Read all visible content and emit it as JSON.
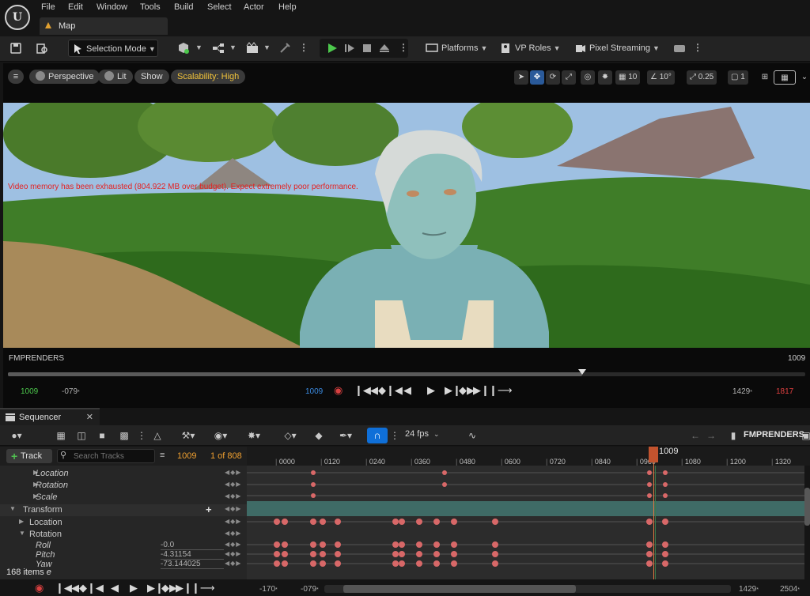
{
  "menu": {
    "items": [
      "File",
      "Edit",
      "Window",
      "Tools",
      "Build",
      "Select",
      "Actor",
      "Help"
    ],
    "tab_label": "Map"
  },
  "toolbar": {
    "selection_mode": "Selection Mode",
    "platforms": "Platforms",
    "vp_roles": "VP Roles",
    "pixel_streaming": "Pixel Streaming"
  },
  "viewport": {
    "perspective": "Perspective",
    "lit": "Lit",
    "show": "Show",
    "scalability": "Scalability: High",
    "grid_snap": "10",
    "rotation_snap": "10°",
    "scale_snap": "0.25",
    "camera_speed": "1",
    "warning": "Video memory has been exhausted (804.922 MB over budget). Expect extremely poor performance."
  },
  "viewport_timeline": {
    "title": "FMPRENDERS",
    "frame": "1009",
    "current": "1009",
    "start": "-079",
    "start_suffix": "*",
    "center": "1009",
    "view_end": "1429",
    "view_end_suffix": "*",
    "end": "1817",
    "progress": 0.72
  },
  "sequencer": {
    "tab_label": "Sequencer",
    "fps": "24 fps",
    "sequence_name": "FMPRENDERS",
    "add_track": "Track",
    "search_placeholder": "Search Tracks",
    "current_frame": "1009",
    "frame_of": "1 of 808",
    "items_count": "168 items",
    "items_suffix": "e",
    "playhead_label": "1009",
    "ruler_ticks": [
      "0000",
      "0120",
      "0240",
      "0360",
      "0480",
      "0600",
      "0720",
      "0840",
      "0960",
      "1080",
      "1200",
      "1320"
    ],
    "rows": [
      {
        "label": "Location",
        "indent": 1,
        "italic": true,
        "arrow": "right",
        "value": ""
      },
      {
        "label": "Rotation",
        "indent": 1,
        "italic": true,
        "arrow": "right",
        "value": ""
      },
      {
        "label": "Scale",
        "indent": 1,
        "italic": true,
        "arrow": "right",
        "value": ""
      },
      {
        "label": "Transform",
        "indent": 0,
        "italic": false,
        "arrow": "down",
        "value": ""
      },
      {
        "label": "Location",
        "indent": 1,
        "italic": false,
        "arrow": "right",
        "value": ""
      },
      {
        "label": "Rotation",
        "indent": 1,
        "italic": false,
        "arrow": "down",
        "value": ""
      },
      {
        "label": "Roll",
        "indent": 2,
        "italic": true,
        "arrow": "",
        "value": "-0.0"
      },
      {
        "label": "Pitch",
        "indent": 2,
        "italic": true,
        "arrow": "",
        "value": "-4.31154"
      },
      {
        "label": "Yaw",
        "indent": 2,
        "italic": true,
        "arrow": "",
        "value": "-73.144025"
      }
    ],
    "bottom": {
      "left_start": "-170",
      "left_start_suffix": "*",
      "left_cur": "-079",
      "left_cur_suffix": "*",
      "right_a": "1429",
      "right_a_suffix": "*",
      "right_b": "2504",
      "right_b_suffix": "*"
    }
  },
  "colors": {
    "accent_blue": "#0f6fd8",
    "play_green": "#4cc84c",
    "warning_red": "#e52020",
    "frame_orange": "#f0a030",
    "key_red": "#d86868",
    "scalability_yellow": "#f0c23a"
  }
}
